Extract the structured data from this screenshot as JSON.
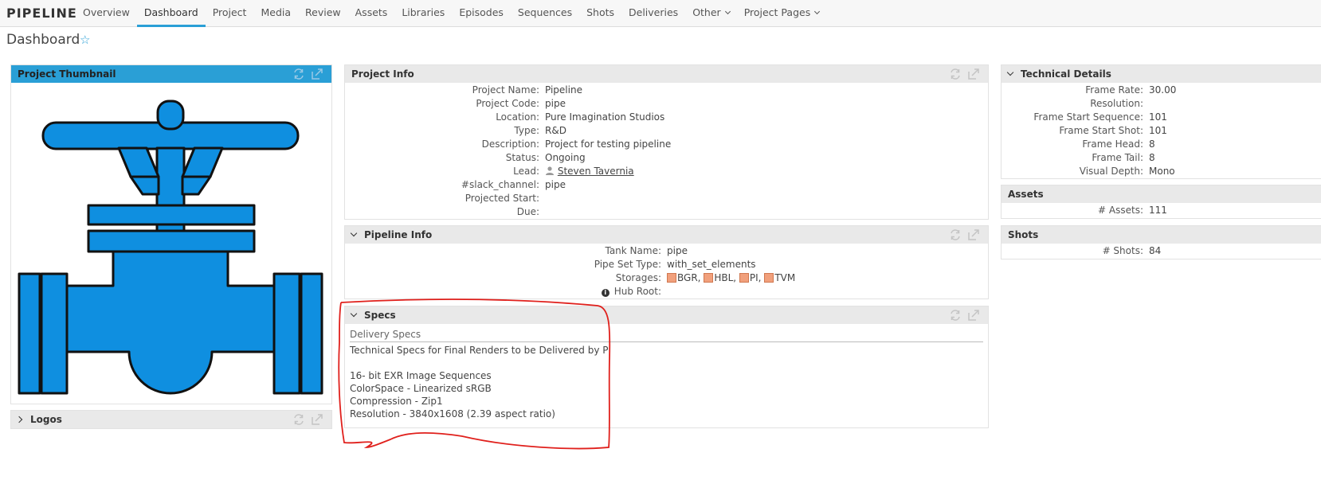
{
  "nav": {
    "brand": "PIPELINE",
    "items": [
      {
        "label": "Overview",
        "active": false,
        "dropdown": false
      },
      {
        "label": "Dashboard",
        "active": true,
        "dropdown": false
      },
      {
        "label": "Project",
        "active": false,
        "dropdown": false
      },
      {
        "label": "Media",
        "active": false,
        "dropdown": false
      },
      {
        "label": "Review",
        "active": false,
        "dropdown": false
      },
      {
        "label": "Assets",
        "active": false,
        "dropdown": false
      },
      {
        "label": "Libraries",
        "active": false,
        "dropdown": false
      },
      {
        "label": "Episodes",
        "active": false,
        "dropdown": false
      },
      {
        "label": "Sequences",
        "active": false,
        "dropdown": false
      },
      {
        "label": "Shots",
        "active": false,
        "dropdown": false
      },
      {
        "label": "Deliveries",
        "active": false,
        "dropdown": false
      },
      {
        "label": "Other",
        "active": false,
        "dropdown": true
      },
      {
        "label": "Project Pages",
        "active": false,
        "dropdown": true
      }
    ]
  },
  "page": {
    "title": "Dashboard",
    "favorite_icon": "star-outline-icon"
  },
  "thumbnail_widget": {
    "title": "Project Thumbnail",
    "image": "pipe-valve-logo"
  },
  "logos_widget": {
    "title": "Logos"
  },
  "project_info": {
    "title": "Project Info",
    "fields": {
      "name": {
        "label": "Project Name:",
        "value": "Pipeline"
      },
      "code": {
        "label": "Project Code:",
        "value": "pipe"
      },
      "location": {
        "label": "Location:",
        "value": "Pure Imagination Studios"
      },
      "type": {
        "label": "Type:",
        "value": "R&D"
      },
      "description": {
        "label": "Description:",
        "value": "Project for testing pipeline"
      },
      "status": {
        "label": "Status:",
        "value": "Ongoing"
      },
      "lead": {
        "label": "Lead:",
        "value": "Steven Tavernia"
      },
      "slack": {
        "label": "#slack_channel:",
        "value": "pipe"
      },
      "projected_start": {
        "label": "Projected Start:",
        "value": ""
      },
      "due": {
        "label": "Due:",
        "value": ""
      }
    }
  },
  "pipeline_info": {
    "title": "Pipeline Info",
    "fields": {
      "tank": {
        "label": "Tank Name:",
        "value": "pipe"
      },
      "pipe_set": {
        "label": "Pipe Set Type:",
        "value": "with_set_elements"
      },
      "storages": {
        "label": "Storages:",
        "items": [
          "BGR,",
          "HBL,",
          "PI,",
          "TVM"
        ]
      },
      "hub_root": {
        "label": "Hub Root:",
        "value": ""
      }
    }
  },
  "specs": {
    "title": "Specs",
    "subheader": "Delivery Specs",
    "lines": [
      "Technical Specs for Final Renders to be Delivered by PI",
      "",
      "16- bit EXR Image Sequences",
      "ColorSpace - Linearized sRGB",
      "Compression - Zip1",
      "Resolution - 3840x1608 (2.39 aspect ratio)"
    ]
  },
  "technical_details": {
    "title": "Technical Details",
    "fields": {
      "frame_rate": {
        "label": "Frame Rate:",
        "value": "30.00"
      },
      "resolution": {
        "label": "Resolution:",
        "value": ""
      },
      "fss": {
        "label": "Frame Start Sequence:",
        "value": "101"
      },
      "fsh": {
        "label": "Frame Start Shot:",
        "value": "101"
      },
      "head": {
        "label": "Frame Head:",
        "value": "8"
      },
      "tail": {
        "label": "Frame Tail:",
        "value": "8"
      },
      "depth": {
        "label": "Visual Depth:",
        "value": "Mono"
      }
    }
  },
  "assets": {
    "title": "Assets",
    "label": "# Assets:",
    "value": "111"
  },
  "shots": {
    "title": "Shots",
    "label": "# Shots:",
    "value": "84"
  },
  "colors": {
    "accent": "#2a9fd6",
    "annotation": "#e0201c",
    "valve_fill": "#0f8fe0"
  }
}
